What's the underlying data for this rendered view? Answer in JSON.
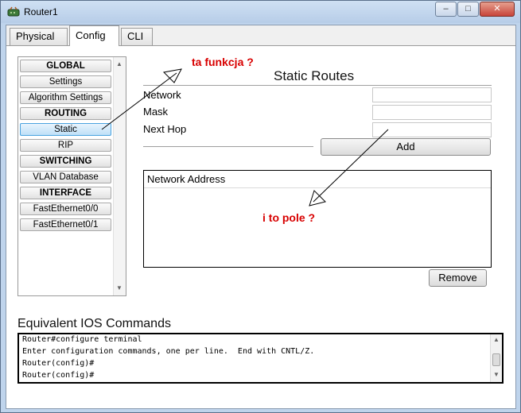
{
  "window": {
    "title": "Router1",
    "minimize_glyph": "–",
    "maximize_glyph": "□",
    "close_glyph": "✕"
  },
  "tabs": [
    {
      "label": "Physical",
      "active": false
    },
    {
      "label": "Config",
      "active": true
    },
    {
      "label": "CLI",
      "active": false
    }
  ],
  "nav": {
    "items": [
      {
        "label": "GLOBAL",
        "kind": "header"
      },
      {
        "label": "Settings",
        "kind": "item"
      },
      {
        "label": "Algorithm Settings",
        "kind": "item"
      },
      {
        "label": "ROUTING",
        "kind": "header"
      },
      {
        "label": "Static",
        "kind": "item",
        "selected": true
      },
      {
        "label": "RIP",
        "kind": "item"
      },
      {
        "label": "SWITCHING",
        "kind": "header"
      },
      {
        "label": "VLAN Database",
        "kind": "item"
      },
      {
        "label": "INTERFACE",
        "kind": "header"
      },
      {
        "label": "FastEthernet0/0",
        "kind": "item"
      },
      {
        "label": "FastEthernet0/1",
        "kind": "item"
      }
    ]
  },
  "static_routes": {
    "title": "Static Routes",
    "network_label": "Network",
    "mask_label": "Mask",
    "next_hop_label": "Next Hop",
    "network_value": "",
    "mask_value": "",
    "next_hop_value": "",
    "add_label": "Add",
    "table_header": "Network Address",
    "remove_label": "Remove"
  },
  "annotations": {
    "function_note": "ta funkcja ?",
    "field_note": "i to pole ?",
    "color": "#d80000"
  },
  "ios": {
    "title": "Equivalent IOS Commands",
    "lines": [
      "Router#configure terminal",
      "Enter configuration commands, one per line.  End with CNTL/Z.",
      "Router(config)#",
      "Router(config)#"
    ]
  }
}
